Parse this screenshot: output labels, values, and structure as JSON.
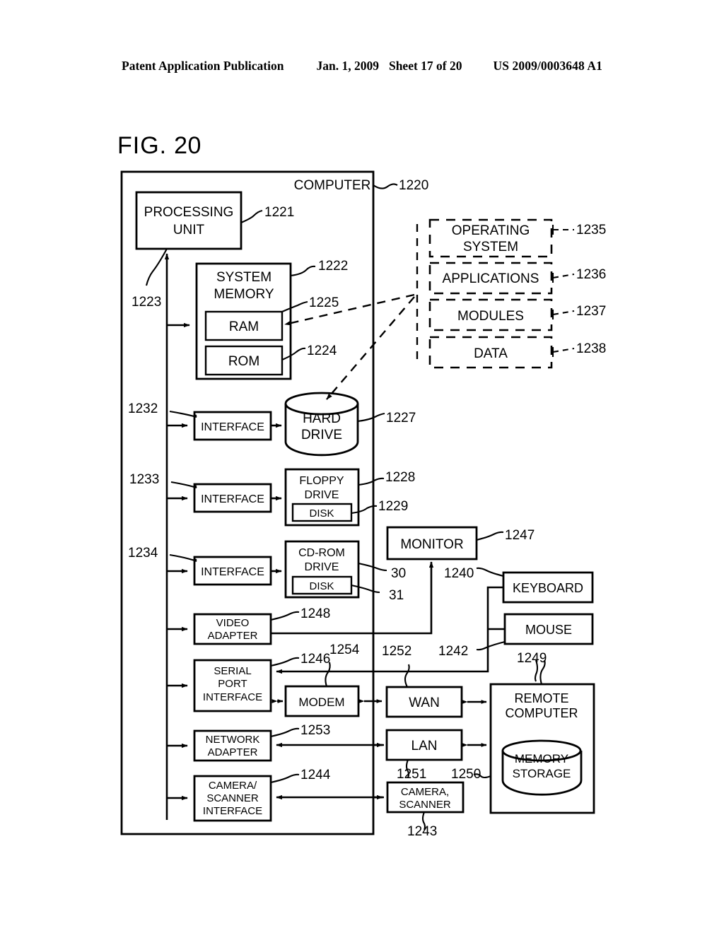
{
  "header": {
    "publication": "Patent Application Publication",
    "date": "Jan. 1, 2009",
    "sheet": "Sheet 17 of 20",
    "patent_number": "US 2009/0003648 A1"
  },
  "figure": {
    "label_prefix": "FIG.",
    "label_number": "20"
  },
  "diagram": {
    "computer_label": "COMPUTER",
    "boxes": {
      "processing_unit_line1": "PROCESSING",
      "processing_unit_line2": "UNIT",
      "system_memory_line1": "SYSTEM",
      "system_memory_line2": "MEMORY",
      "ram": "RAM",
      "rom": "ROM",
      "operating_system_line1": "OPERATING",
      "operating_system_line2": "SYSTEM",
      "applications": "APPLICATIONS",
      "modules": "MODULES",
      "data": "DATA",
      "interface_hard": "INTERFACE",
      "interface_floppy": "INTERFACE",
      "interface_cdrom": "INTERFACE",
      "hard_drive_line1": "HARD",
      "hard_drive_line2": "DRIVE",
      "floppy_drive_line1": "FLOPPY",
      "floppy_drive_line2": "DRIVE",
      "floppy_disk": "DISK",
      "cdrom_drive_line1": "CD-ROM",
      "cdrom_drive_line2": "DRIVE",
      "cdrom_disk": "DISK",
      "video_adapter_line1": "VIDEO",
      "video_adapter_line2": "ADAPTER",
      "serial_port_line1": "SERIAL",
      "serial_port_line2": "PORT",
      "serial_port_line3": "INTERFACE",
      "network_adapter_line1": "NETWORK",
      "network_adapter_line2": "ADAPTER",
      "camera_scanner_if_line1": "CAMERA/",
      "camera_scanner_if_line2": "SCANNER",
      "camera_scanner_if_line3": "INTERFACE",
      "modem": "MODEM",
      "monitor": "MONITOR",
      "keyboard": "KEYBOARD",
      "mouse": "MOUSE",
      "wan": "WAN",
      "lan": "LAN",
      "camera_scanner_line1": "CAMERA,",
      "camera_scanner_line2": "SCANNER",
      "remote_computer_line1": "REMOTE",
      "remote_computer_line2": "COMPUTER",
      "memory_storage_line1": "MEMORY",
      "memory_storage_line2": "STORAGE"
    },
    "reference_numerals": {
      "computer": "1220",
      "processing_unit": "1221",
      "system_memory": "1222",
      "bus": "1223",
      "rom": "1224",
      "ram": "1225",
      "hard_drive": "1227",
      "floppy_drive": "1228",
      "floppy_disk": "1229",
      "interface_hard": "1232",
      "interface_floppy": "1233",
      "interface_cdrom": "1234",
      "operating_system": "1235",
      "applications": "1236",
      "modules": "1237",
      "data": "1238",
      "keyboard": "1240",
      "mouse": "1242",
      "camera_scanner": "1243",
      "camera_scanner_interface": "1244",
      "serial_port_interface": "1246",
      "monitor": "1247",
      "video_adapter": "1248",
      "mouse_cable": "1249",
      "remote_computer": "1250",
      "lan": "1251",
      "wan": "1252",
      "network_adapter": "1253",
      "modem": "1254",
      "cdrom_drive": "30",
      "cdrom_disk": "31"
    }
  }
}
